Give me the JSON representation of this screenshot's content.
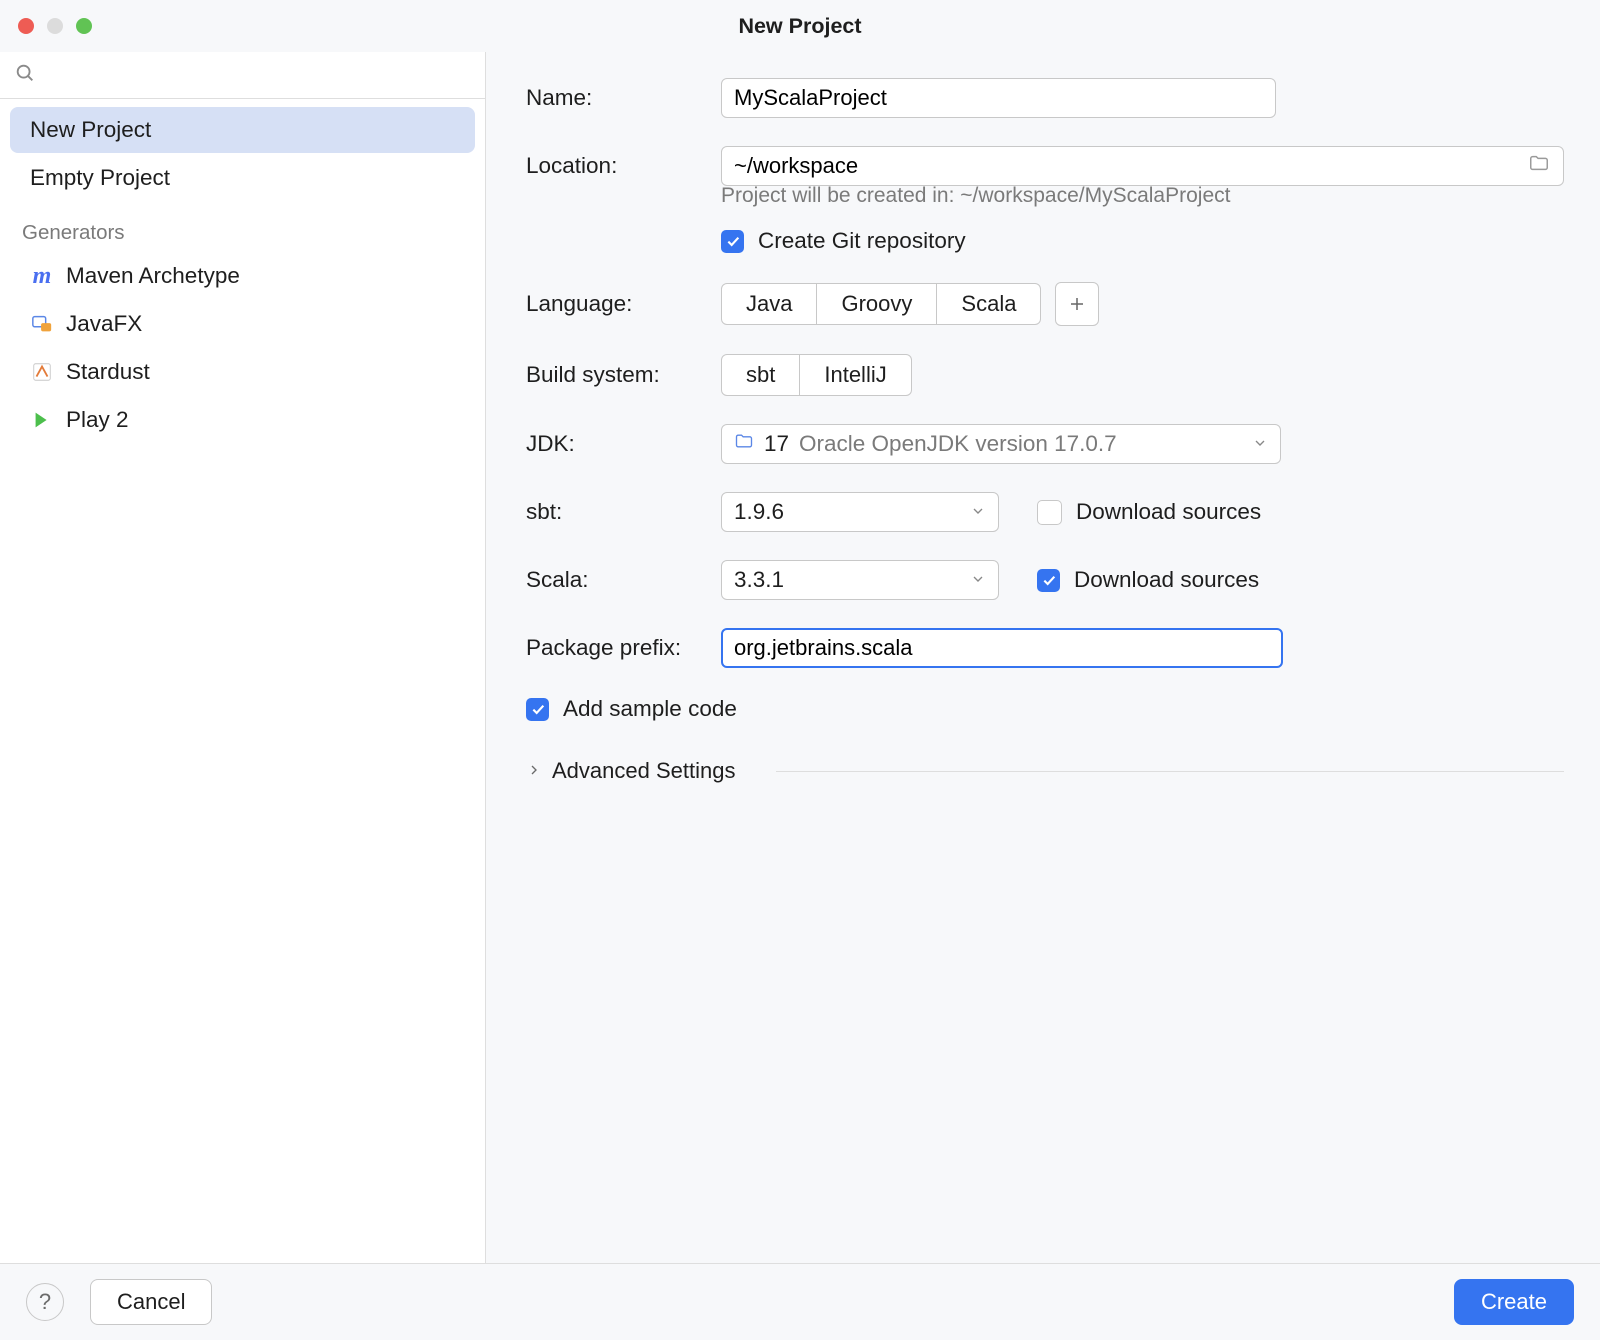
{
  "window": {
    "title": "New Project"
  },
  "sidebar": {
    "search_placeholder": "",
    "items": [
      {
        "label": "New Project"
      },
      {
        "label": "Empty Project"
      }
    ],
    "generators_heading": "Generators",
    "generators": [
      {
        "label": "Maven Archetype",
        "icon": "maven-icon"
      },
      {
        "label": "JavaFX",
        "icon": "javafx-icon"
      },
      {
        "label": "Stardust",
        "icon": "stardust-icon"
      },
      {
        "label": "Play 2",
        "icon": "play-icon"
      }
    ]
  },
  "form": {
    "name": {
      "label": "Name:",
      "value": "MyScalaProject"
    },
    "location": {
      "label": "Location:",
      "value": "~/workspace",
      "hint": "Project will be created in: ~/workspace/MyScalaProject"
    },
    "git": {
      "label": "Create Git repository",
      "checked": true
    },
    "language": {
      "label": "Language:",
      "options": [
        "Java",
        "Groovy",
        "Scala"
      ],
      "selected": "Scala"
    },
    "build": {
      "label": "Build system:",
      "options": [
        "sbt",
        "IntelliJ"
      ],
      "selected": "sbt"
    },
    "jdk": {
      "label": "JDK:",
      "version": "17",
      "desc": "Oracle OpenJDK version 17.0.7"
    },
    "sbt": {
      "label": "sbt:",
      "value": "1.9.6",
      "download_label": "Download sources",
      "download_checked": false
    },
    "scala": {
      "label": "Scala:",
      "value": "3.3.1",
      "download_label": "Download sources",
      "download_checked": true
    },
    "package_prefix": {
      "label": "Package prefix:",
      "value": "org.jetbrains.scala"
    },
    "sample": {
      "label": "Add sample code",
      "checked": true
    },
    "advanced": {
      "label": "Advanced Settings"
    }
  },
  "footer": {
    "help": "?",
    "cancel": "Cancel",
    "create": "Create"
  }
}
